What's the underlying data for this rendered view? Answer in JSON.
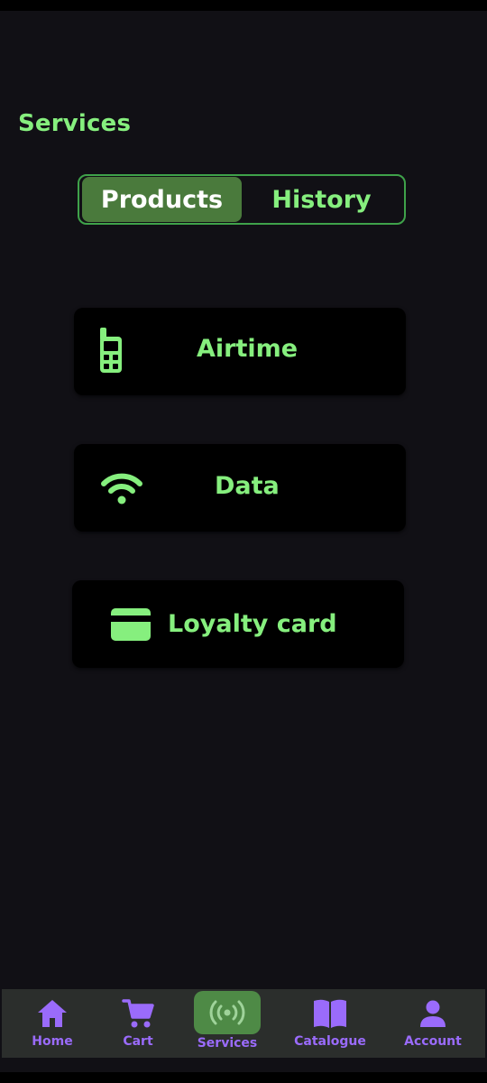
{
  "header": {
    "title": "Services"
  },
  "tabs": [
    {
      "label": "Products",
      "active": true
    },
    {
      "label": "History",
      "active": false
    }
  ],
  "services": [
    {
      "label": "Airtime",
      "icon": "phone-icon"
    },
    {
      "label": "Data",
      "icon": "wifi-icon"
    },
    {
      "label": "Loyalty card",
      "icon": "credit-card-icon"
    }
  ],
  "bottom_nav": {
    "items": [
      {
        "label": "Home",
        "icon": "home-icon",
        "active": false
      },
      {
        "label": "Cart",
        "icon": "cart-icon",
        "active": false
      },
      {
        "label": "Services",
        "icon": "broadcast-icon",
        "active": true
      },
      {
        "label": "Catalogue",
        "icon": "book-icon",
        "active": false
      },
      {
        "label": "Account",
        "icon": "person-icon",
        "active": false
      }
    ]
  },
  "colors": {
    "accent_green": "#86ef7e",
    "active_tab_bg": "#4a7a3c",
    "nav_purple": "#9a6bfb",
    "background": "#111015"
  }
}
